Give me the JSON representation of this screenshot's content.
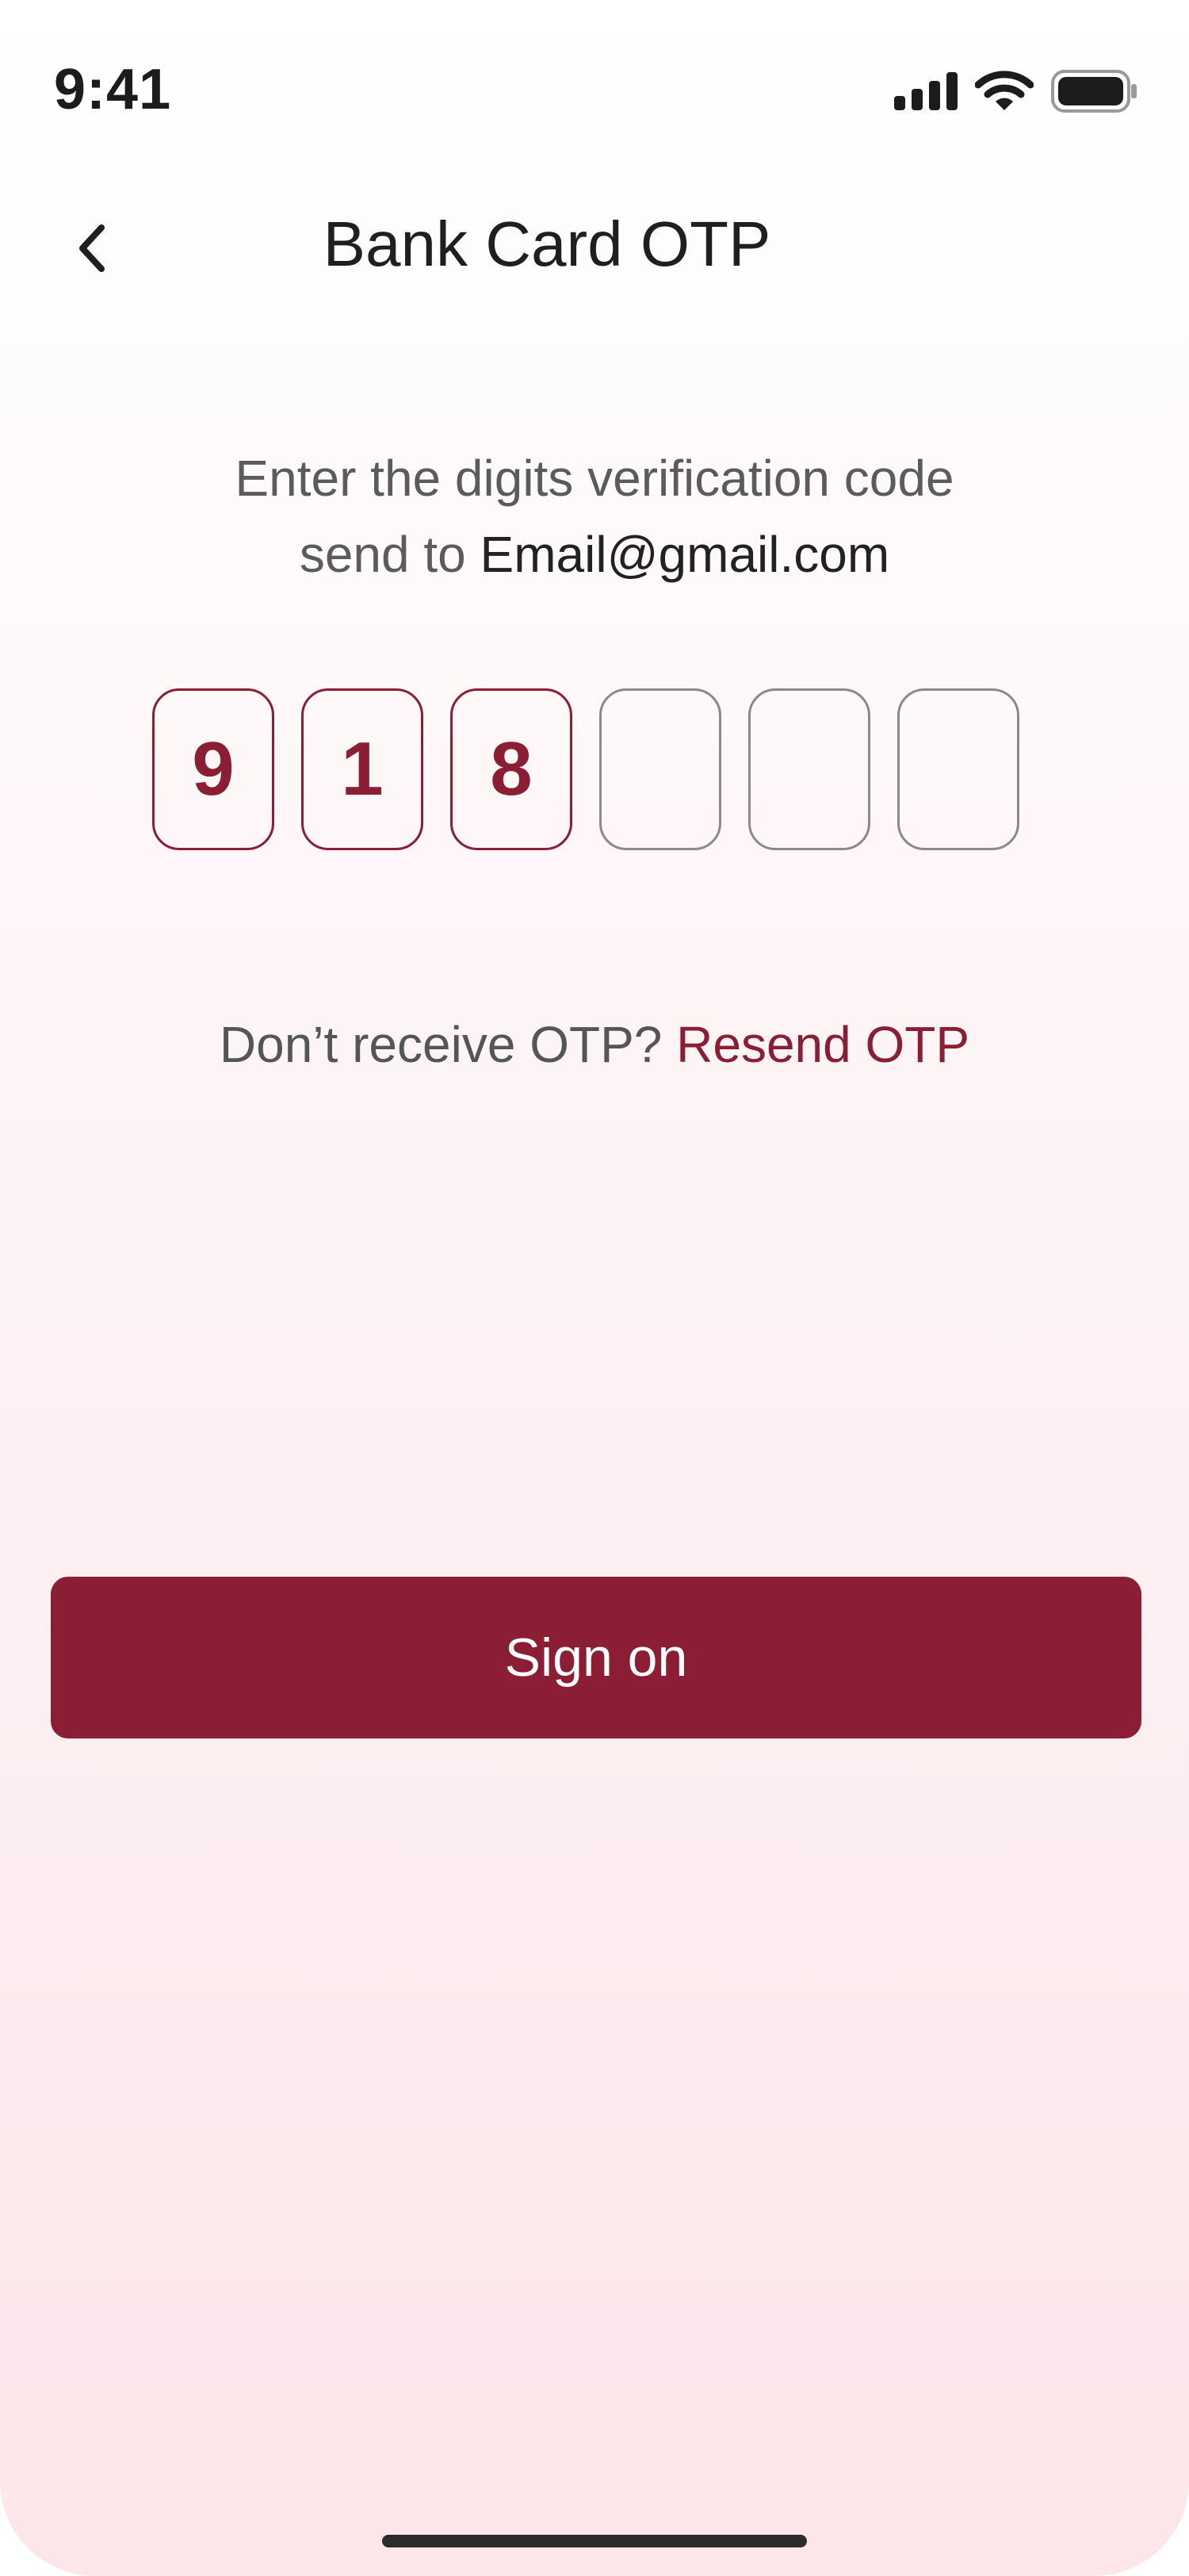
{
  "status_bar": {
    "time": "9:41",
    "icons": [
      "cellular-signal-icon",
      "wifi-icon",
      "battery-icon"
    ]
  },
  "header": {
    "back_icon": "chevron-left-icon",
    "title": "Bank Card OTP"
  },
  "instruction": {
    "line1": "Enter the digits verification code",
    "line2_prefix": "send to ",
    "email": "Email@gmail.com"
  },
  "otp": {
    "digits": [
      "9",
      "1",
      "8",
      "",
      "",
      ""
    ]
  },
  "resend": {
    "question": "Don’t receive OTP? ",
    "link_label": "Resend OTP"
  },
  "actions": {
    "sign_on_label": "Sign on"
  },
  "colors": {
    "accent": "#8b1d35",
    "text_primary": "#1f1f1f",
    "text_secondary": "#5b5b5b",
    "box_border_empty": "#8a8a8a",
    "background_top": "#ffffff",
    "background_bottom": "#fce6ea"
  }
}
